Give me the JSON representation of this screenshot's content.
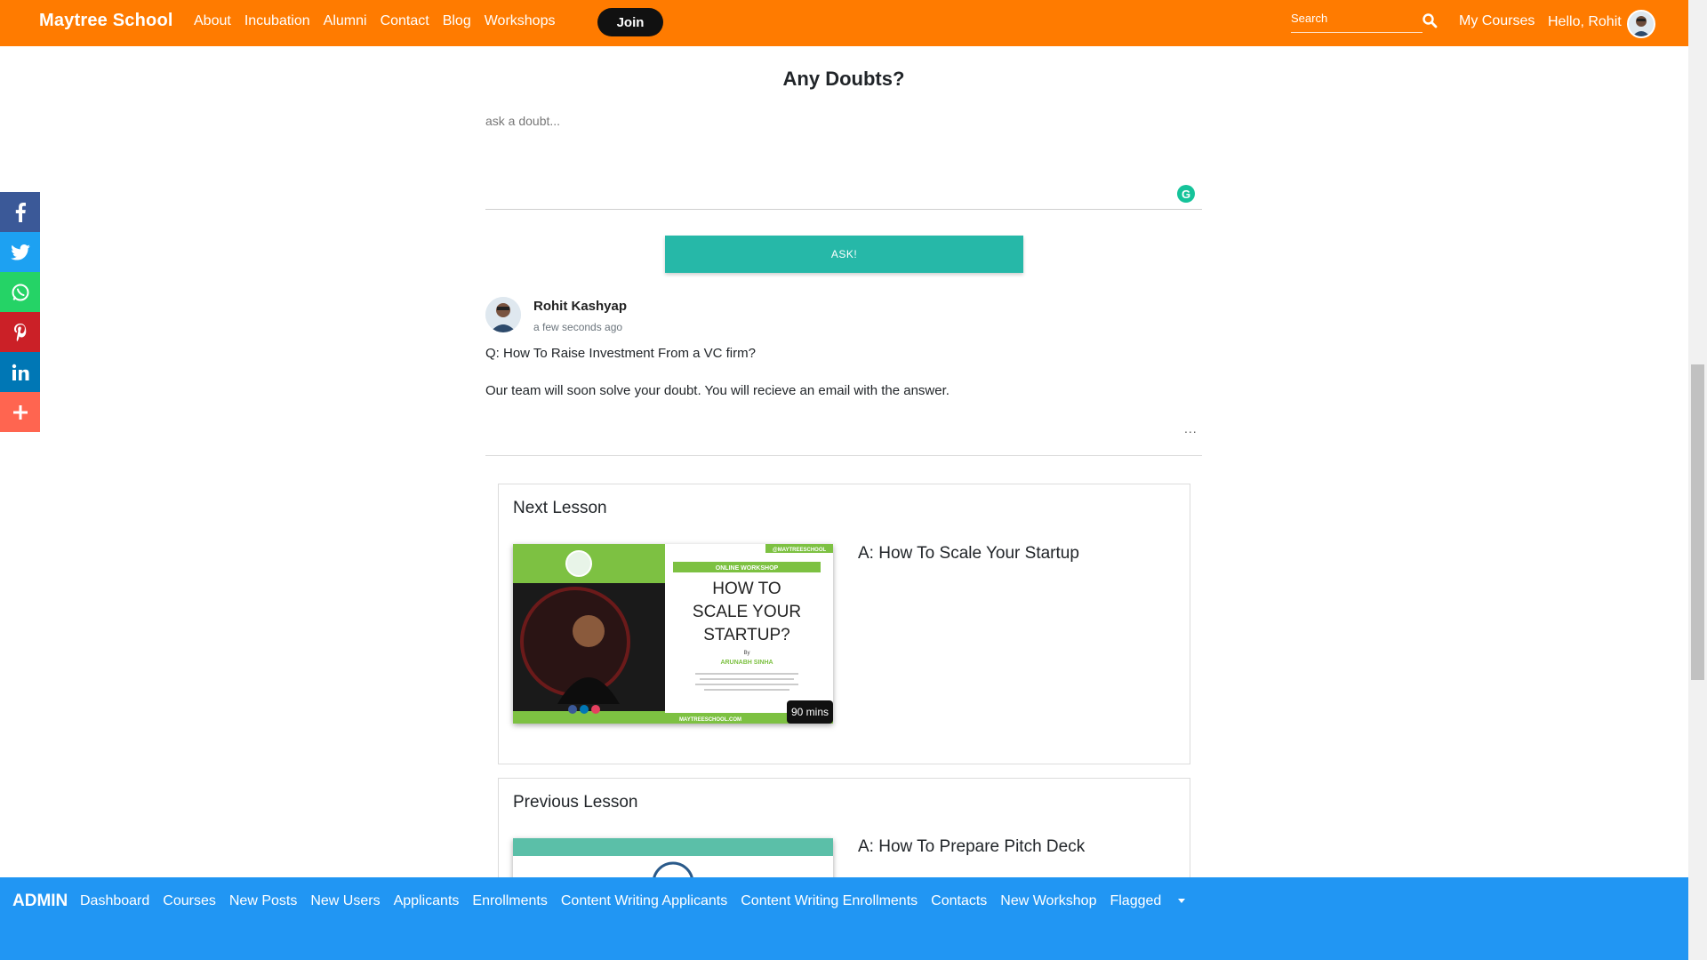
{
  "topnav": {
    "brand": "Maytree School",
    "links": [
      "About",
      "Incubation",
      "Alumni",
      "Contact",
      "Blog",
      "Workshops"
    ],
    "join_label": "Join",
    "search_placeholder": "Search",
    "my_courses": "My Courses",
    "hello": "Hello, Rohit",
    "bg_color": "#ff7b00"
  },
  "share": {
    "icons": [
      "facebook-icon",
      "twitter-icon",
      "whatsapp-icon",
      "pinterest-icon",
      "linkedin-icon",
      "more-icon"
    ],
    "colors": [
      "#3b5998",
      "#1da1f2",
      "#25d366",
      "#cb2027",
      "#0077b5",
      "#ff6550"
    ]
  },
  "doubts": {
    "title": "Any Doubts?",
    "placeholder": "ask a doubt...",
    "ask_label": "ASK!",
    "ask_color": "#26b8a8"
  },
  "comment": {
    "name": "Rohit Kashyap",
    "time": "a few seconds ago",
    "question": "Q: How To Raise Investment From a VC firm?",
    "answer": "Our team will soon solve your doubt. You will recieve an email with the answer.",
    "more": "..."
  },
  "next_lesson": {
    "label": "Next Lesson",
    "title": "A: How To Scale Your Startup",
    "thumb_tag": "@MAYTREESCHOOL",
    "thumb_banner": "ONLINE WORKSHOP",
    "thumb_heading_1": "HOW TO",
    "thumb_heading_2": "SCALE YOUR",
    "thumb_heading_3": "STARTUP?",
    "thumb_by": "By",
    "thumb_speaker": "ARUNABH SINHA",
    "thumb_site": "MAYTREESCHOOL.COM",
    "duration": "90 mins"
  },
  "prev_lesson": {
    "label": "Previous Lesson",
    "title": "A: How To Prepare Pitch Deck"
  },
  "admin": {
    "title": "ADMIN",
    "links": [
      "Dashboard",
      "Courses",
      "New Posts",
      "New Users",
      "Applicants",
      "Enrollments",
      "Content Writing Applicants",
      "Content Writing Enrollments",
      "Contacts",
      "New Workshop"
    ],
    "flagged": "Flagged",
    "bg_color": "#2196f3"
  }
}
